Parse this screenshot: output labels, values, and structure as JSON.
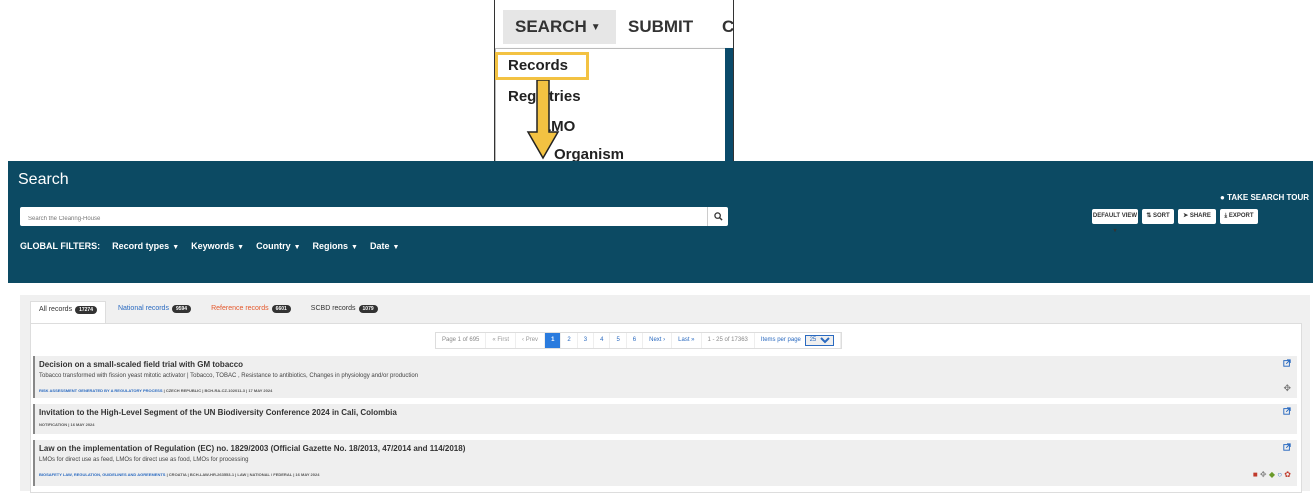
{
  "top_menu": {
    "search_label": "SEARCH",
    "submit_label": "SUBMIT",
    "partial_label": "C",
    "dropdown": {
      "records": "Records",
      "registries": "Registries",
      "lmo": "LMO",
      "organism": "Organism"
    },
    "highlight_color": "#f3c242"
  },
  "panel": {
    "title": "Search",
    "take_tour": "TAKE SEARCH TOUR",
    "search_placeholder": "Search the Clearing-House",
    "toolbar": {
      "default_view": "DEFAULT VIEW",
      "sort": "SORT",
      "share": "SHARE",
      "export": "EXPORT"
    },
    "filters_label": "GLOBAL FILTERS:",
    "filters": [
      "Record types",
      "Keywords",
      "Country",
      "Regions",
      "Date"
    ],
    "header_color": "#0c4a63"
  },
  "tabs": [
    {
      "label": "All records",
      "count": "17274"
    },
    {
      "label": "National records",
      "count": "9594"
    },
    {
      "label": "Reference records",
      "count": "6601"
    },
    {
      "label": "SCBD records",
      "count": "1079"
    }
  ],
  "pager": {
    "page_of": "Page 1 of 695",
    "first": "« First",
    "prev": "‹ Prev",
    "pages": [
      "1",
      "2",
      "3",
      "4",
      "5",
      "6"
    ],
    "next": "Next ›",
    "last": "Last »",
    "range": "1 - 25 of 17363",
    "items_per_page_label": "Items per page",
    "items_per_page_value": "25"
  },
  "records": [
    {
      "title": "Decision on a small-scaled field trial with GM tobacco",
      "description": "Tobacco transformed with fission yeast mitotic activator | Tobacco, TOBAC , Resistance to antibiotics, Changes in physiology and/or production",
      "meta_link": "RISK ASSESSMENT GENERATED BY A REGULATORY PROCESS",
      "meta_rest": " | CZECH REPUBLIC | BCH-RA-CZ-102011-3 | 17 MAY 2024"
    },
    {
      "title": "Invitation to the High-Level Segment of the UN Biodiversity Conference 2024 in Cali, Colombia",
      "description": "",
      "meta_link": "",
      "meta_rest": "NOTIFICATION | 16 MAY 2024"
    },
    {
      "title": "Law on the implementation of Regulation (EC) no. 1829/2003 (Official Gazette No. 18/2013, 47/2014 and 114/2018)",
      "description": "LMOs for direct use as feed, LMOs for direct use as food, LMOs for processing",
      "meta_link": "BIOSAFETY LAW, REGULATION, GUIDELINES AND AGREEMENTS",
      "meta_rest": " | CROATIA | BCH-LAW-HR-263553-1 | LAW | NATIONAL / FEDERAL | 16 MAY 2024"
    }
  ]
}
